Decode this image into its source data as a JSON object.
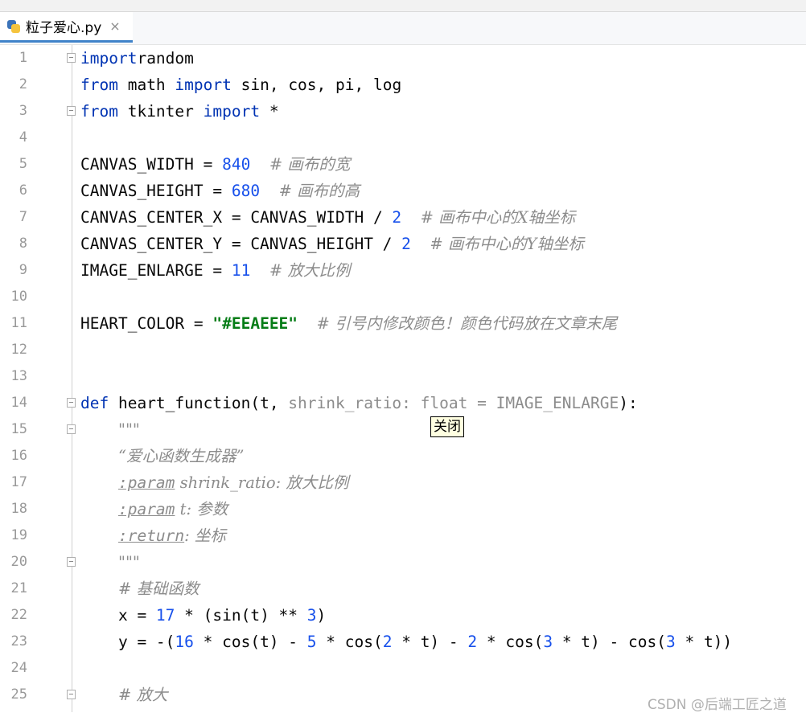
{
  "tab": {
    "label": "粒子爱心.py",
    "close": "×"
  },
  "tooltip": "关闭",
  "watermark": "CSDN @后端工匠之道",
  "lines": [
    {
      "n": "1",
      "fold": "open",
      "tokens": [
        [
          "kw",
          "import"
        ],
        [
          "",
          "random"
        ]
      ]
    },
    {
      "n": "2",
      "tokens": [
        [
          "kw",
          "from"
        ],
        [
          "",
          " math "
        ],
        [
          "kw",
          "import"
        ],
        [
          "",
          " sin, cos, pi, log"
        ]
      ]
    },
    {
      "n": "3",
      "fold": "open",
      "tokens": [
        [
          "kw",
          "from"
        ],
        [
          "",
          " tkinter "
        ],
        [
          "kw",
          "import"
        ],
        [
          "",
          " *"
        ]
      ]
    },
    {
      "n": "4",
      "tokens": []
    },
    {
      "n": "5",
      "tokens": [
        [
          "",
          "CANVAS_WIDTH = "
        ],
        [
          "num",
          "840"
        ],
        [
          "",
          "  "
        ],
        [
          "cm",
          "# 画布的宽"
        ]
      ]
    },
    {
      "n": "6",
      "tokens": [
        [
          "",
          "CANVAS_HEIGHT = "
        ],
        [
          "num",
          "680"
        ],
        [
          "",
          "  "
        ],
        [
          "cm",
          "# 画布的高"
        ]
      ]
    },
    {
      "n": "7",
      "tokens": [
        [
          "",
          "CANVAS_CENTER_X = CANVAS_WIDTH / "
        ],
        [
          "num",
          "2"
        ],
        [
          "",
          "  "
        ],
        [
          "cm",
          "# 画布中心的X轴坐标"
        ]
      ]
    },
    {
      "n": "8",
      "tokens": [
        [
          "",
          "CANVAS_CENTER_Y = CANVAS_HEIGHT / "
        ],
        [
          "num",
          "2"
        ],
        [
          "",
          "  "
        ],
        [
          "cm",
          "# 画布中心的Y轴坐标"
        ]
      ]
    },
    {
      "n": "9",
      "tokens": [
        [
          "",
          "IMAGE_ENLARGE = "
        ],
        [
          "num",
          "11"
        ],
        [
          "",
          "  "
        ],
        [
          "cm",
          "# 放大比例"
        ]
      ]
    },
    {
      "n": "10",
      "tokens": []
    },
    {
      "n": "11",
      "tokens": [
        [
          "",
          "HEART_COLOR = "
        ],
        [
          "str",
          "\"#EEAEEE\""
        ],
        [
          "",
          "  "
        ],
        [
          "cm",
          "# 引号内修改颜色！颜色代码放在文章末尾"
        ]
      ]
    },
    {
      "n": "12",
      "tokens": []
    },
    {
      "n": "13",
      "tokens": []
    },
    {
      "n": "14",
      "fold": "open",
      "tokens": [
        [
          "kw",
          "def"
        ],
        [
          "",
          " heart_function(t, "
        ],
        [
          "hint",
          "shrink_ratio: float = IMAGE_ENLARGE"
        ],
        [
          "",
          "):"
        ]
      ]
    },
    {
      "n": "15",
      "fold": "open",
      "tokens": [
        [
          "",
          "    "
        ],
        [
          "doc",
          "\"\"\""
        ]
      ]
    },
    {
      "n": "16",
      "tokens": [
        [
          "",
          "    "
        ],
        [
          "doc",
          "“爱心函数生成器”"
        ]
      ]
    },
    {
      "n": "17",
      "tokens": [
        [
          "",
          "    "
        ],
        [
          "param",
          ":param"
        ],
        [
          "doc",
          " shrink_ratio: 放大比例"
        ]
      ]
    },
    {
      "n": "18",
      "tokens": [
        [
          "",
          "    "
        ],
        [
          "param",
          ":param"
        ],
        [
          "doc",
          " t: 参数"
        ]
      ]
    },
    {
      "n": "19",
      "tokens": [
        [
          "",
          "    "
        ],
        [
          "param",
          ":return"
        ],
        [
          "doc",
          ": 坐标"
        ]
      ]
    },
    {
      "n": "20",
      "fold": "open",
      "tokens": [
        [
          "",
          "    "
        ],
        [
          "doc",
          "\"\"\""
        ]
      ]
    },
    {
      "n": "21",
      "tokens": [
        [
          "",
          "    "
        ],
        [
          "cm",
          "# 基础函数"
        ]
      ]
    },
    {
      "n": "22",
      "tokens": [
        [
          "",
          "    x = "
        ],
        [
          "num",
          "17"
        ],
        [
          "",
          " * (sin(t) ** "
        ],
        [
          "num",
          "3"
        ],
        [
          "",
          ")"
        ]
      ]
    },
    {
      "n": "23",
      "tokens": [
        [
          "",
          "    y = -("
        ],
        [
          "num",
          "16"
        ],
        [
          "",
          " * cos(t) - "
        ],
        [
          "num",
          "5"
        ],
        [
          "",
          " * cos("
        ],
        [
          "num",
          "2"
        ],
        [
          "",
          " * t) - "
        ],
        [
          "num",
          "2"
        ],
        [
          "",
          " * cos("
        ],
        [
          "num",
          "3"
        ],
        [
          "",
          " * t) - cos("
        ],
        [
          "num",
          "3"
        ],
        [
          "",
          " * t))"
        ]
      ]
    },
    {
      "n": "24",
      "tokens": []
    },
    {
      "n": "25",
      "fold": "open",
      "tokens": [
        [
          "",
          "    "
        ],
        [
          "cm",
          "# 放大"
        ]
      ]
    }
  ]
}
